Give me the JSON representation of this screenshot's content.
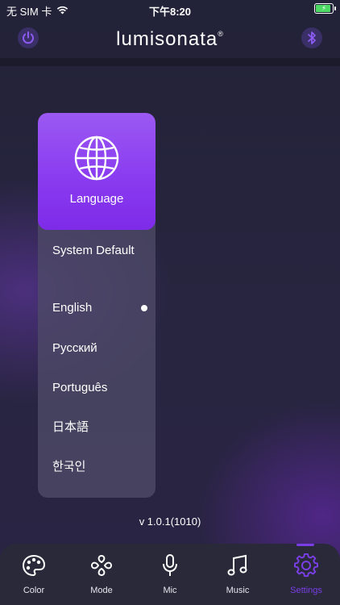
{
  "status_bar": {
    "carrier": "无 SIM 卡",
    "time": "下午8:20"
  },
  "header": {
    "brand": "lumisonata",
    "trademark": "®",
    "left_icon": "power-icon",
    "right_icon": "bluetooth-icon"
  },
  "language_panel": {
    "title": "Language",
    "icon": "globe-icon",
    "options": [
      {
        "label": "System Default",
        "selected": false
      },
      {
        "label": "English",
        "selected": true
      },
      {
        "label": "Русский",
        "selected": false
      },
      {
        "label": "Português",
        "selected": false
      },
      {
        "label": "日本語",
        "selected": false
      },
      {
        "label": "한국인",
        "selected": false
      }
    ]
  },
  "version": "v 1.0.1(1010)",
  "tabs": [
    {
      "label": "Color",
      "icon": "palette-icon",
      "active": false
    },
    {
      "label": "Mode",
      "icon": "mode-icon",
      "active": false
    },
    {
      "label": "Mic",
      "icon": "mic-icon",
      "active": false
    },
    {
      "label": "Music",
      "icon": "music-icon",
      "active": false
    },
    {
      "label": "Settings",
      "icon": "gear-icon",
      "active": true
    }
  ],
  "colors": {
    "accent": "#7a3ee6",
    "panel_header": "#8a3cf0",
    "background": "#23223a",
    "battery": "#4cd964"
  }
}
